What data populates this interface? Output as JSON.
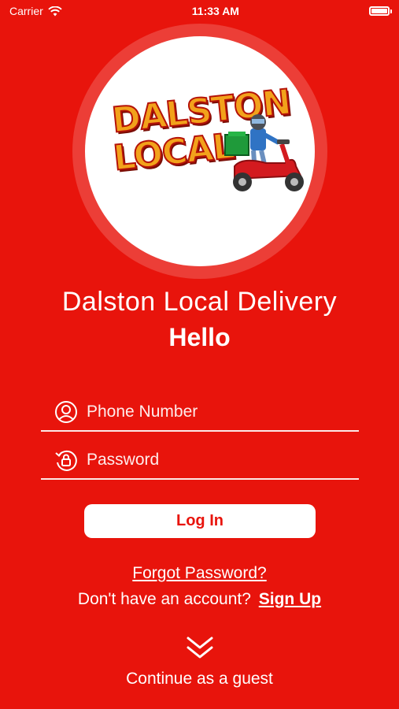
{
  "status_bar": {
    "carrier": "Carrier",
    "time": "11:33 AM"
  },
  "logo": {
    "line1": "DALSTON",
    "line2": "LOCAL"
  },
  "header": {
    "app_title": "Dalston Local Delivery",
    "greeting": "Hello"
  },
  "form": {
    "phone_placeholder": "Phone Number",
    "password_placeholder": "Password",
    "login_label": "Log In"
  },
  "links": {
    "forgot_password": "Forgot Password?",
    "no_account": "Don't have an account?",
    "sign_up": "Sign Up",
    "continue_guest": "Continue as a guest"
  },
  "colors": {
    "background": "#e8140c",
    "button": "#ffffff",
    "button_text": "#e8140c"
  }
}
